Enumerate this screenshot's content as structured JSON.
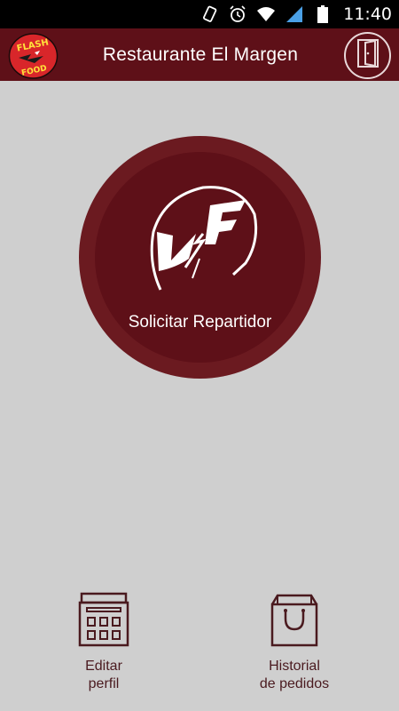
{
  "status_bar": {
    "time": "11:40",
    "icons": [
      "phone-vibrate-icon",
      "alarm-icon",
      "wifi-icon",
      "signal-icon",
      "battery-icon"
    ]
  },
  "app_bar": {
    "logo_text_top": "FLASH",
    "logo_text_bottom": "FOOD",
    "title": "Restaurante El Margen",
    "exit_icon": "exit-door-icon"
  },
  "main_action": {
    "label": "Solicitar Repartidor",
    "icon": "helmet-logo-icon"
  },
  "bottom_nav": [
    {
      "label": "Editar\nperfil",
      "icon": "building-icon"
    },
    {
      "label": "Historial\nde pedidos",
      "icon": "shopping-bag-icon"
    }
  ],
  "colors": {
    "brand": "#5e1018",
    "brand_ring": "#6b1a20",
    "background": "#cfcfcf",
    "icon_stroke": "#4a1a1f"
  }
}
